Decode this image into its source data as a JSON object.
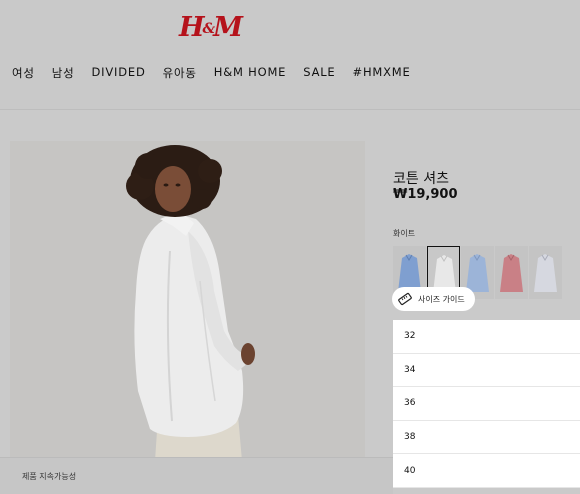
{
  "brand": {
    "logo": "H&M",
    "color": "#b5121b"
  },
  "nav": {
    "items": [
      "여성",
      "남성",
      "DIVIDED",
      "유아동",
      "H&M HOME",
      "SALE",
      "#HMXME"
    ]
  },
  "product": {
    "title": "코튼 셔츠",
    "price": "₩19,900",
    "color_label": "화이트",
    "swatches": [
      {
        "name": "blue-swatch",
        "color": "#7f9fd0"
      },
      {
        "name": "white-swatch",
        "color": "#e4e4e4"
      },
      {
        "name": "light-blue-swatch",
        "color": "#9cb4d8"
      },
      {
        "name": "pink-stripe-swatch",
        "color": "#c98086"
      },
      {
        "name": "white-stripe-swatch",
        "color": "#d6d8e0"
      }
    ],
    "size_guide_label": "사이즈 가이드",
    "size_guide_icon": "ruler-icon"
  },
  "sizes": [
    "32",
    "34",
    "36",
    "38",
    "40"
  ],
  "footer": {
    "label": "제품 지속가능성"
  }
}
